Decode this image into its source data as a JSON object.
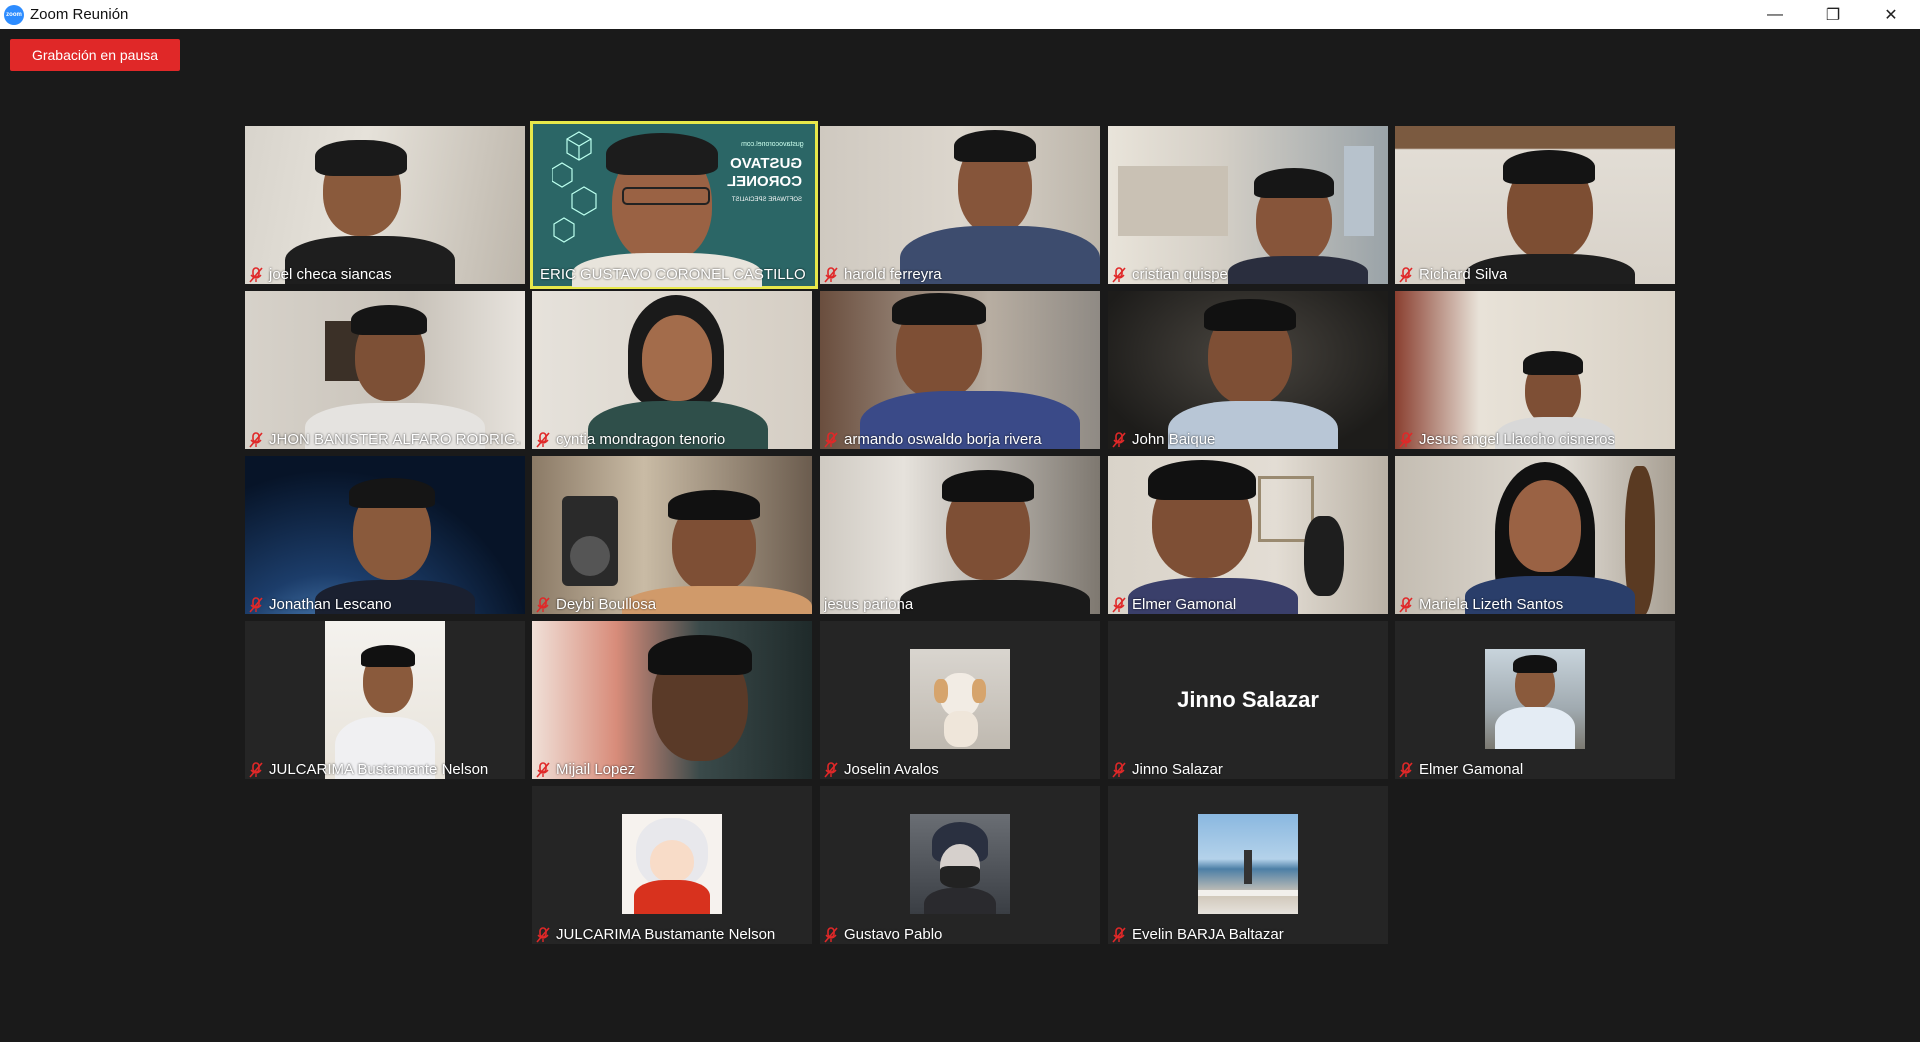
{
  "window": {
    "title": "Zoom Reunión",
    "logo_text": "zoom",
    "minimize": "—",
    "restore": "❐",
    "close": "✕"
  },
  "recording": {
    "label": "Grabación en pausa"
  },
  "colors": {
    "background": "#1a1a1a",
    "tile": "#252525",
    "active_border": "#e8e84a",
    "record_button": "#e02828",
    "muted_icon": "#e02828"
  },
  "participants": [
    {
      "name": "joel checa siancas",
      "muted": true,
      "video": true
    },
    {
      "name": "ERIC GUSTAVO CORONEL CASTILLO",
      "muted": false,
      "video": true,
      "active_speaker": true,
      "background_text": [
        "GUSTAVO",
        "CORONEL",
        "SOFTWARE SPECIALIST",
        "gustavocoronel.com"
      ]
    },
    {
      "name": "harold ferreyra",
      "muted": true,
      "video": true
    },
    {
      "name": "cristian quispe",
      "muted": true,
      "video": true
    },
    {
      "name": "Richard Silva",
      "muted": true,
      "video": true
    },
    {
      "name": "JHON BANISTER ALFARO RODRIG...",
      "muted": true,
      "video": true
    },
    {
      "name": "cyntia mondragon tenorio",
      "muted": true,
      "video": true
    },
    {
      "name": "armando oswaldo borja rivera",
      "muted": true,
      "video": true
    },
    {
      "name": "John Baique",
      "muted": true,
      "video": true
    },
    {
      "name": "Jesus angel Llaccho cisneros",
      "muted": true,
      "video": true
    },
    {
      "name": "Jonathan Lescano",
      "muted": true,
      "video": true
    },
    {
      "name": "Deybi Boullosa",
      "muted": true,
      "video": true
    },
    {
      "name": "jesus pariona",
      "muted": false,
      "video": true
    },
    {
      "name": "Elmer Gamonal",
      "muted": true,
      "video": true
    },
    {
      "name": "Mariela Lizeth Santos",
      "muted": true,
      "video": true
    },
    {
      "name": "JULCARIMA Bustamante Nelson",
      "muted": true,
      "video": true
    },
    {
      "name": "Mijail Lopez",
      "muted": true,
      "video": true
    },
    {
      "name": "Joselin Avalos",
      "muted": true,
      "video": false,
      "avatar": "dog-photo"
    },
    {
      "name": "Jinno Salazar",
      "muted": true,
      "video": false,
      "display_text": "Jinno Salazar"
    },
    {
      "name": "Elmer Gamonal",
      "muted": true,
      "video": false,
      "avatar": "person-photo"
    },
    {
      "name": "JULCARIMA Bustamante Nelson",
      "muted": true,
      "video": false,
      "avatar": "anime-photo"
    },
    {
      "name": "Gustavo Pablo",
      "muted": true,
      "video": false,
      "avatar": "masked-photo"
    },
    {
      "name": "Evelin BARJA  Baltazar",
      "muted": true,
      "video": false,
      "avatar": "beach-photo"
    }
  ]
}
